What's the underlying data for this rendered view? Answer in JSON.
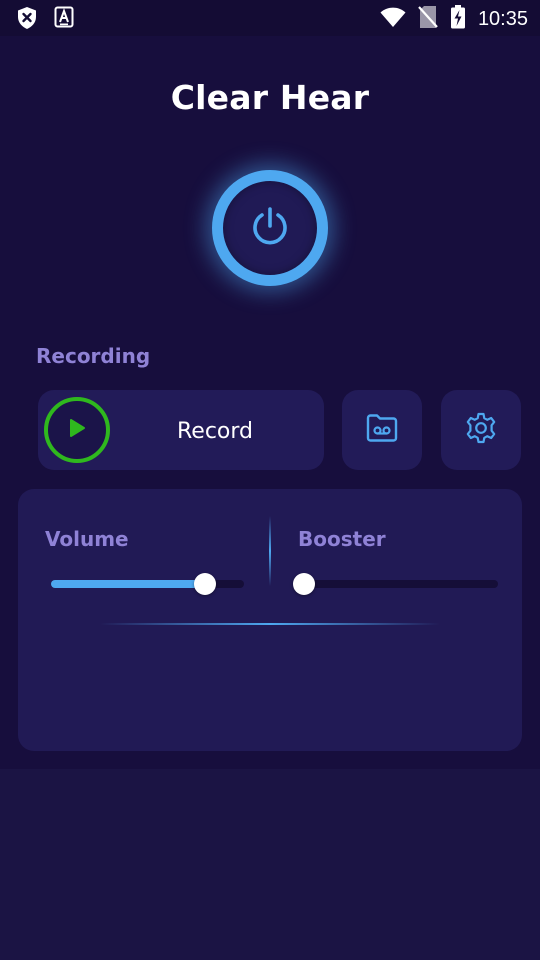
{
  "status_bar": {
    "time": "10:35",
    "left_icons": [
      "shield-x-icon",
      "accessibility-a-icon"
    ],
    "right_icons": [
      "wifi-icon",
      "no-sim-icon",
      "battery-charging-icon"
    ]
  },
  "app": {
    "title": "Clear Hear",
    "power_icon": "power-icon"
  },
  "recording": {
    "section_label": "Recording",
    "record_label": "Record",
    "play_icon": "play-icon",
    "recordings_icon": "voicemail-folder-icon",
    "settings_icon": "gear-icon"
  },
  "controls": {
    "volume": {
      "label": "Volume",
      "level": 0.8
    },
    "booster": {
      "label": "Booster",
      "level": 0.0
    }
  },
  "colors": {
    "accent": "#4ea8f0",
    "play_green": "#2fb81e",
    "label_purple": "#8f82d6",
    "background": "#170e3d",
    "card": "#221b58"
  }
}
